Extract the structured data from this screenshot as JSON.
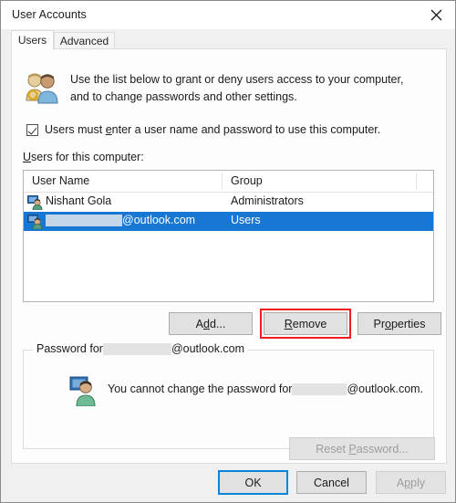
{
  "window": {
    "title": "User Accounts",
    "close_icon": "close-icon"
  },
  "tabs": [
    {
      "label": "Users",
      "active": true
    },
    {
      "label": "Advanced",
      "active": false
    }
  ],
  "description": {
    "icon": "users-key-icon",
    "line1": "Use the list below to grant or deny users access to your computer,",
    "line2": "and to change passwords and other settings."
  },
  "checkbox": {
    "checked": true,
    "label_before": "Users must ",
    "label_accel": "e",
    "label_after": "nter a user name and password to use this computer."
  },
  "list": {
    "label_accel": "U",
    "label_rest": "sers for this computer:",
    "columns": [
      "User Name",
      "Group"
    ],
    "rows": [
      {
        "icon": "user-account-icon",
        "name": "Nishant Gola",
        "name_redacted": false,
        "group": "Administrators",
        "selected": false
      },
      {
        "icon": "user-account-icon",
        "name_redacted": true,
        "name_suffix": "@outlook.com",
        "group": "Users",
        "selected": true
      }
    ]
  },
  "action_buttons": {
    "add": {
      "accel": "d",
      "before": "A",
      "after": "d..."
    },
    "remove": {
      "accel": "R",
      "before": "",
      "after": "emove",
      "highlighted": true,
      "highlight_color": "#ee1c1c"
    },
    "properties": {
      "accel": "o",
      "before": "Pr",
      "after": "perties"
    }
  },
  "password_group": {
    "legend_before": "Password for ",
    "legend_after": "@outlook.com",
    "icon": "user-monitor-icon",
    "message_before": "You cannot change the password for ",
    "message_after": "@outlook.com.",
    "reset_button": {
      "before": "Reset ",
      "accel": "P",
      "after": "assword...",
      "disabled": true
    }
  },
  "footer": {
    "ok": "OK",
    "cancel": "Cancel",
    "apply_before": "A",
    "apply_accel": "p",
    "apply_after": "ply",
    "apply_disabled": true,
    "ok_focus_color": "#0a84d8"
  }
}
